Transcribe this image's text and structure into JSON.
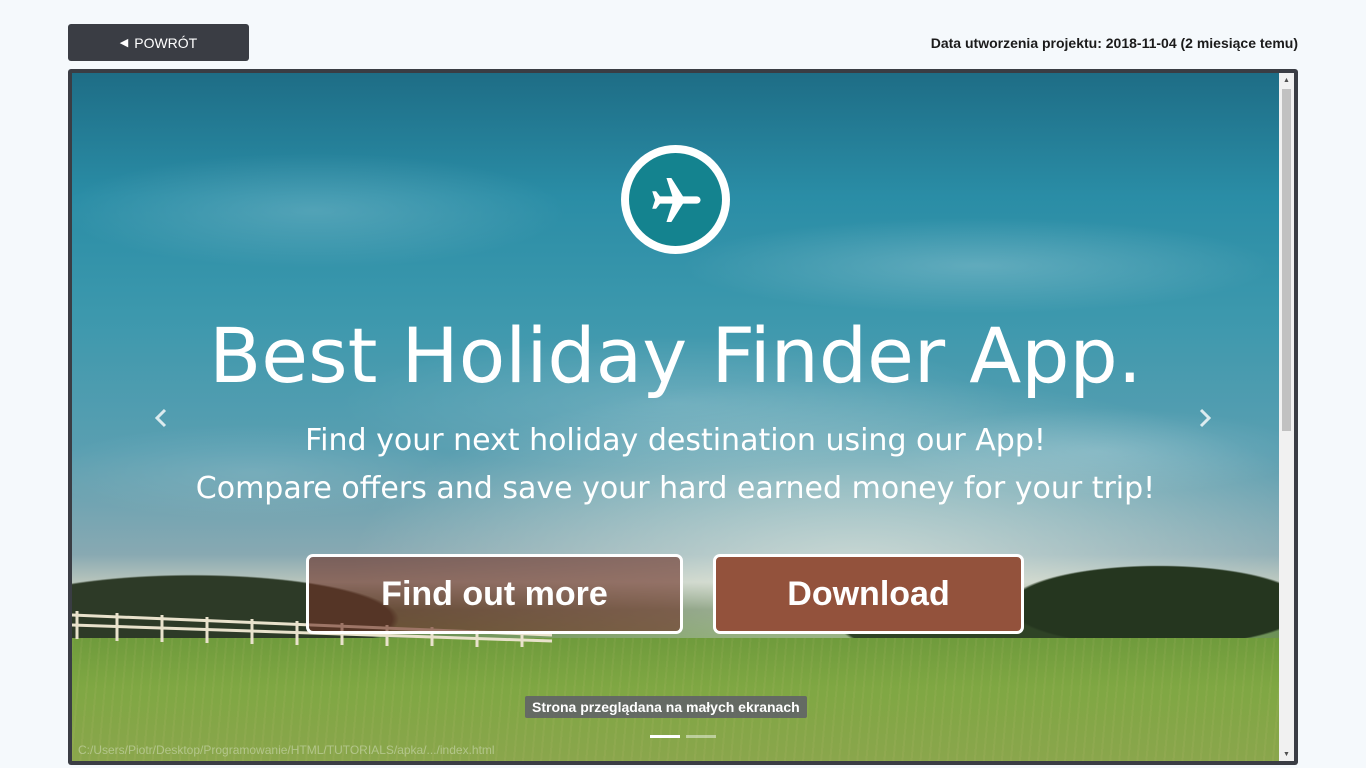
{
  "header": {
    "back_button_label": "POWRÓT",
    "back_icon": "left-triangle-icon",
    "created_date_text": "Data utworzenia projektu: 2018-11-04 (2 miesiące temu)"
  },
  "preview": {
    "logo_icon": "airplane-icon",
    "title": "Best Holiday Finder App.",
    "subtitle_line1": "Find your next holiday destination using our App!",
    "subtitle_line2": "Compare offers and save your hard earned money for your trip!",
    "find_out_more_label": "Find out more",
    "download_label": "Download",
    "prev_icon": "chevron-left-icon",
    "next_icon": "chevron-right-icon",
    "small_screen_badge": "Strona przeglądana na małych ekranach",
    "status_url": "C:/Users/Piotr/Desktop/Programowanie/HTML/TUTORIALS/apka/.../index.html",
    "carousel_slides": 2,
    "active_slide": 1
  },
  "colors": {
    "back_button_bg": "#3a3d44",
    "logo_teal": "#14838f",
    "download_bg": "#93523c",
    "find_out_more_bg": "rgba(110,50,38,0.62)"
  }
}
